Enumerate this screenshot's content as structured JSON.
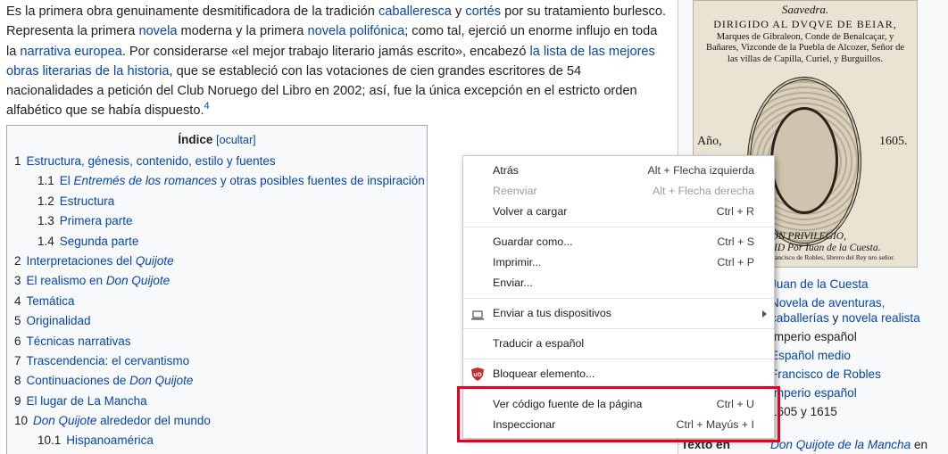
{
  "intro": {
    "p1": "Es la primera obra genuinamente desmitificadora de la tradición ",
    "l_caballeresca": "caballeresca",
    "t_y": " y ",
    "l_cortes": "cortés",
    "p2": " por su tratamiento burlesco. Representa la primera ",
    "l_novela": "novela",
    "p3": " moderna y la primera ",
    "l_polifonica": "novela polifónica",
    "p4": "; como tal, ejerció un enorme influjo en toda la ",
    "l_europea": "narrativa europea",
    "p5": ". Por considerarse «el mejor trabajo literario jamás escrito», encabezó ",
    "l_lista": "la lista de las mejores obras literarias de la historia",
    "p6": ", que se estableció con las votaciones de cien grandes escritores de 54 nacionalidades a petición del Club Noruego del Libro en 2002; así, fue la única excepción en el estricto orden alfabético que se había dispuesto.",
    "ref": "4"
  },
  "toc": {
    "title": "Índice",
    "toggle": "[ocultar]",
    "items": [
      {
        "num": "1",
        "label": "Estructura, génesis, contenido, estilo y fuentes"
      },
      {
        "num": "1.1",
        "label": "El ",
        "label_i": "Entremés de los romances",
        "label_after": " y otras posibles fuentes de inspiración"
      },
      {
        "num": "1.2",
        "label": "Estructura"
      },
      {
        "num": "1.3",
        "label": "Primera parte"
      },
      {
        "num": "1.4",
        "label": "Segunda parte"
      },
      {
        "num": "2",
        "label": "Interpretaciones del ",
        "label_i": "Quijote"
      },
      {
        "num": "3",
        "label": "El realismo en ",
        "label_i": "Don Quijote"
      },
      {
        "num": "4",
        "label": "Temática"
      },
      {
        "num": "5",
        "label": "Originalidad"
      },
      {
        "num": "6",
        "label": "Técnicas narrativas"
      },
      {
        "num": "7",
        "label": "Trascendencia: el cervantismo"
      },
      {
        "num": "8",
        "label": "Continuaciones de ",
        "label_i": "Don Quijote"
      },
      {
        "num": "9",
        "label": "El lugar de La Mancha"
      },
      {
        "num": "10",
        "label": "",
        "label_i": "Don Quijote",
        "label_after": " alrededor del mundo"
      },
      {
        "num": "10.1",
        "label": "Hispanoamérica"
      }
    ]
  },
  "book": {
    "line1": "Saavedra.",
    "line2": "DIRIGIDO AL DVQVE DE BEIAR,",
    "line3": "Marques de Gibraleon, Conde de Benalcaçar, y Bañares, Vizconde de la Puebla de Alcozer, Señor de las villas de Capilla, Curiel, y Burguillos.",
    "ano": "Año,",
    "year": "1605.",
    "privilegio": "CON PRIVILEGIO,",
    "madrid": "EN MADRID  Por Iuan de la Cuesta.",
    "caption": "Vendese en casa de Francisco de Robles, librero del Rey nro señor."
  },
  "infobox": {
    "rows": [
      {
        "value": "Juan de la Cuesta"
      },
      {
        "value": "Novela de aventuras,"
      },
      {
        "value": "caballerías",
        "value_b": " y ",
        "value_c": "novela realista"
      },
      {
        "value": "Imperio español"
      },
      {
        "value": "Español medio"
      },
      {
        "value": "Francisco de Robles"
      },
      {
        "value": "Imperio español"
      },
      {
        "value": "1605 y 1615"
      }
    ],
    "last_label": "Texto en",
    "last_value": "Don Quijote de la Mancha",
    "last_after": " en"
  },
  "context_menu": {
    "items": [
      {
        "label": "Atrás",
        "shortcut": "Alt + Flecha izquierda",
        "disabled": false
      },
      {
        "label": "Reenviar",
        "shortcut": "Alt + Flecha derecha",
        "disabled": true
      },
      {
        "label": "Volver a cargar",
        "shortcut": "Ctrl + R",
        "disabled": false
      },
      {
        "label": "Guardar como...",
        "shortcut": "Ctrl + S",
        "disabled": false
      },
      {
        "label": "Imprimir...",
        "shortcut": "Ctrl + P",
        "disabled": false
      },
      {
        "label": "Enviar...",
        "shortcut": "",
        "disabled": false
      },
      {
        "label": "Enviar a tus dispositivos",
        "shortcut": "",
        "icon": "laptop-icon",
        "submenu": true
      },
      {
        "label": "Traducir a español",
        "shortcut": ""
      },
      {
        "label": "Bloquear elemento...",
        "shortcut": "",
        "icon": "ublock-shield-icon"
      },
      {
        "label": "Ver código fuente de la página",
        "shortcut": "Ctrl + U"
      },
      {
        "label": "Inspeccionar",
        "shortcut": "Ctrl + Mayús + I"
      }
    ]
  },
  "colors": {
    "link": "#0645ad",
    "highlight": "#e8001c",
    "ublock": "#c4302b"
  }
}
